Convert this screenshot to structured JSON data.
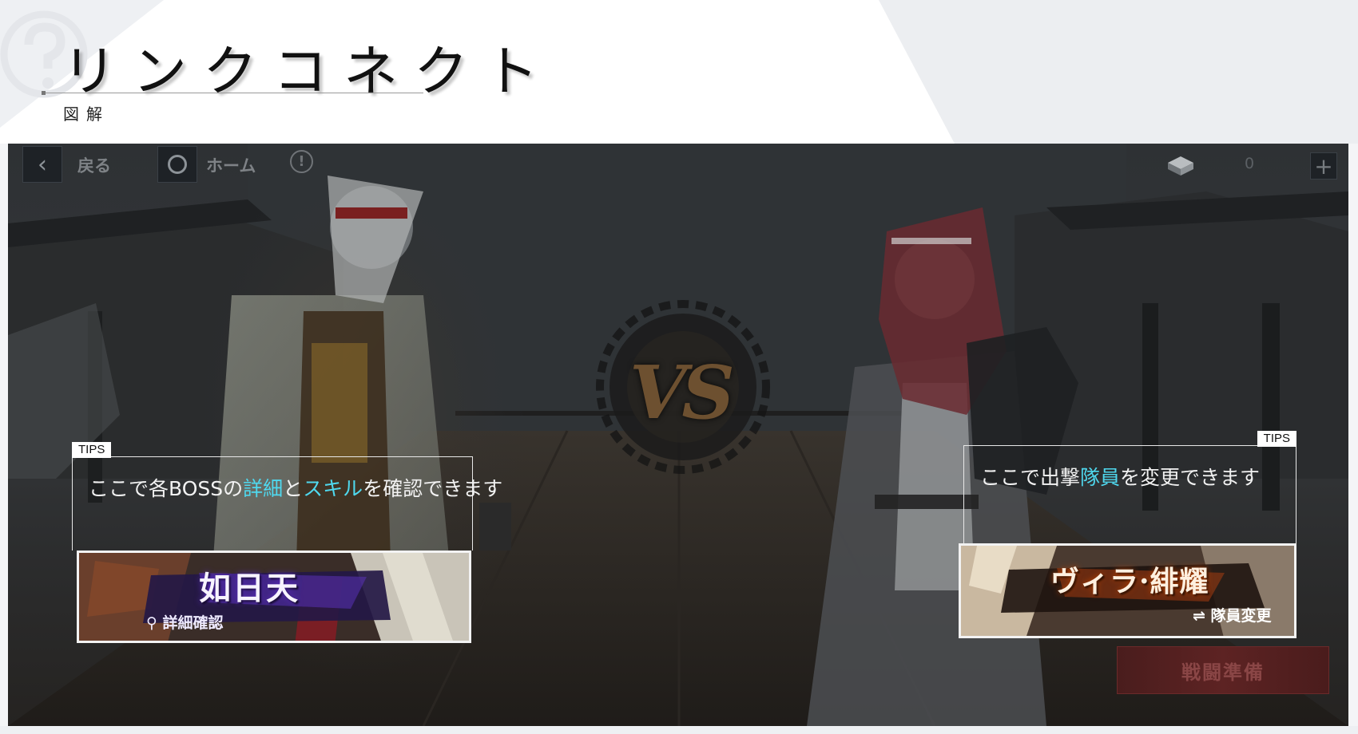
{
  "header": {
    "title": "リンクコネクト",
    "subtitle": "図解"
  },
  "game": {
    "topbar": {
      "back_label": "戻る",
      "home_label": "ホーム",
      "stamina_count": "0"
    },
    "vs_text": "VS",
    "tips": {
      "tag": "TIPS",
      "boss": {
        "pre": "ここで各BOSSの",
        "hl1": "詳細",
        "mid": "と",
        "hl2": "スキル",
        "post": "を確認できます"
      },
      "team": {
        "pre": "ここで出撃",
        "hl": "隊員",
        "post": "を変更できます"
      }
    },
    "boss_card": {
      "name": "如日天",
      "action": "詳細確認"
    },
    "team_card": {
      "name": "ヴィラ·緋耀",
      "action": "隊員変更"
    },
    "battle_button": "戦闘準備"
  },
  "colors": {
    "highlight": "#4fd8ee",
    "battle_button": "#5d2323",
    "panel_bg": "#2e3134"
  }
}
